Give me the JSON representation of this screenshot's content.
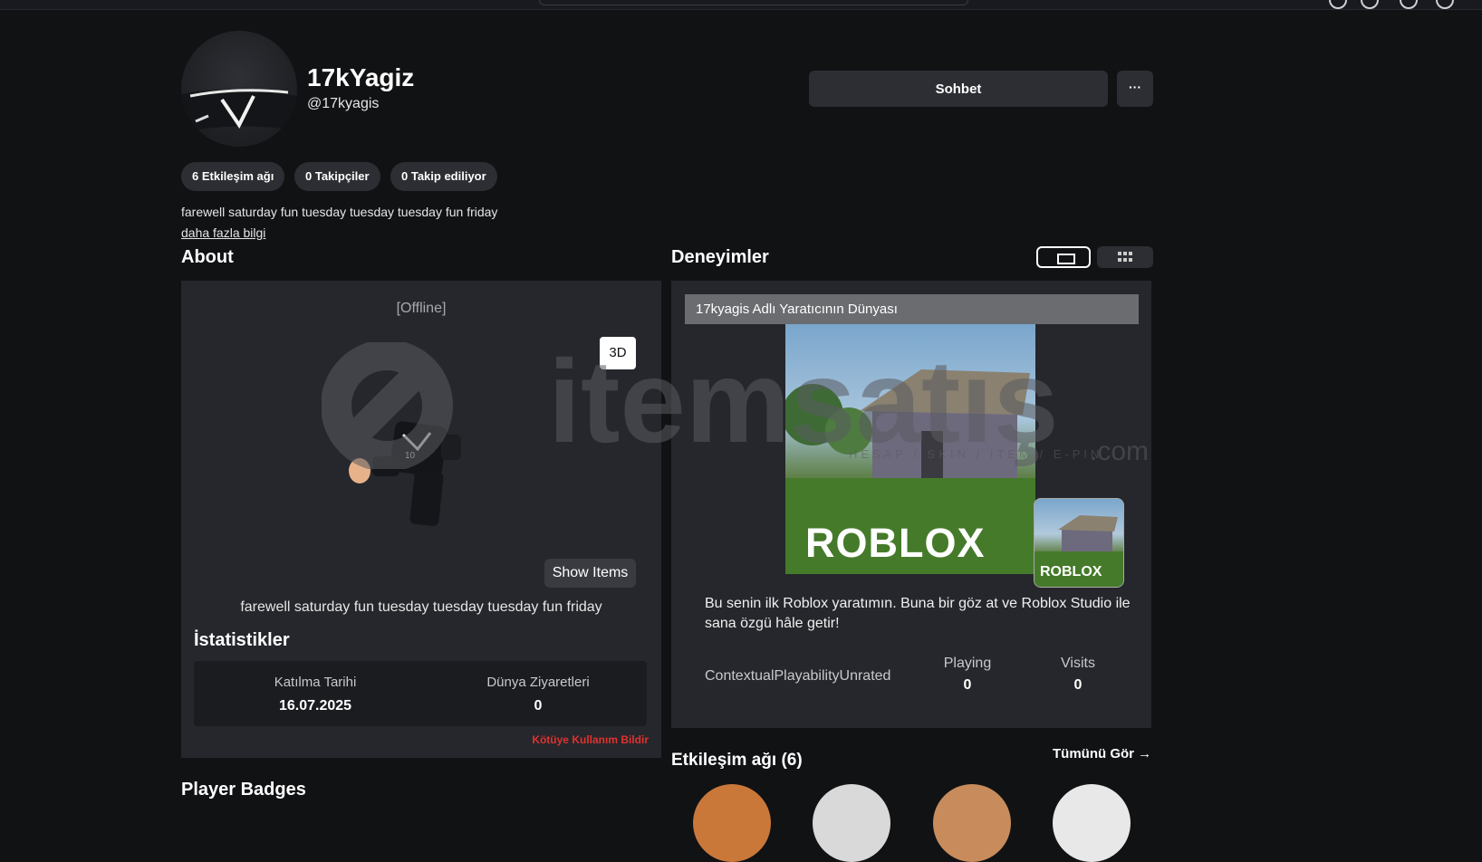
{
  "profile": {
    "display_name": "17kYagiz",
    "username": "@17kyagis",
    "chat_button": "Sohbet",
    "more_button": "···",
    "stats_pills": [
      "6 Etkileşim ağı",
      "0 Takipçiler",
      "0 Takip ediliyor"
    ],
    "description": "farewell saturday fun tuesday tuesday tuesday fun friday",
    "read_more": "daha fazla bilgi"
  },
  "about": {
    "title": "About",
    "status": "[Offline]",
    "btn_3d": "3D",
    "show_items": "Show Items",
    "text": "farewell saturday fun tuesday tuesday tuesday fun friday",
    "stats_title": "İstatistikler",
    "join_label": "Katılma Tarihi",
    "join_value": "16.07.2025",
    "visits_label": "Dünya Ziyaretleri",
    "visits_value": "0",
    "report": "Kötüye Kullanım Bildir"
  },
  "experiences": {
    "title": "Deneyimler",
    "banner": "17kyagis Adlı Yaratıcının Dünyası",
    "logo_text": "ROBLOX",
    "thumb_logo": "ROBLOX",
    "description": "Bu senin ilk Roblox yaratımın. Buna bir göz at ve Roblox Studio ile sana özgü hâle getir!",
    "playability": "ContextualPlayabilityUnrated",
    "playing_label": "Playing",
    "playing_value": "0",
    "visits_label": "Visits",
    "visits_value": "0"
  },
  "connections": {
    "title": "Etkileşim ağı (6)",
    "see_all": "Tümünü Gör →"
  },
  "badges": {
    "title": "Player Badges"
  },
  "watermark": {
    "brand": "itemsatış",
    "tagline": "HESAP / SKIN / ITEM / E-PIN",
    "domain": ".com"
  }
}
